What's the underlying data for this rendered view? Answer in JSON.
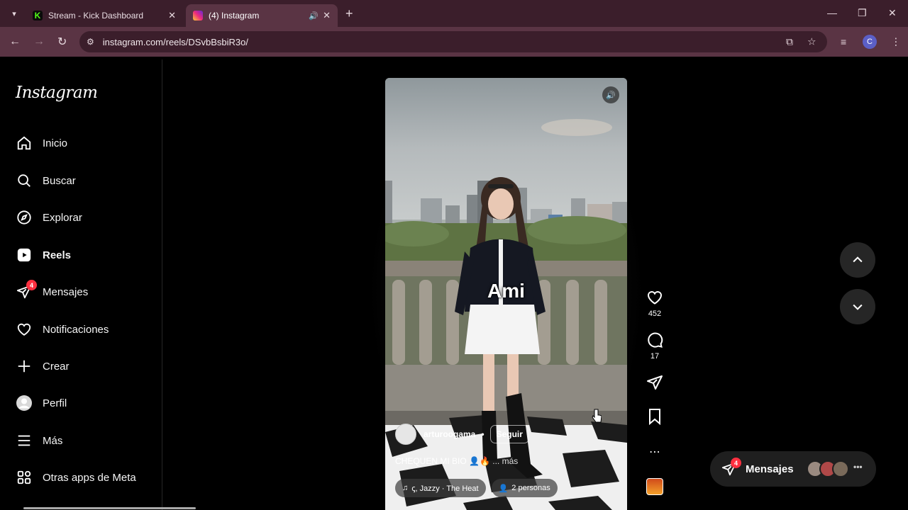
{
  "browser": {
    "tabs": [
      {
        "label": "Stream - Kick Dashboard",
        "favicon_color": "#53fc18",
        "favicon_letter": "K"
      },
      {
        "label": "(4) Instagram",
        "favicon_color": "#d6249f"
      }
    ],
    "url": "instagram.com/reels/DSvbBsbiR3o/",
    "profile_initial": "C"
  },
  "sidebar": {
    "logo": "Instagram",
    "items": [
      {
        "label": "Inicio",
        "icon": "home-icon"
      },
      {
        "label": "Buscar",
        "icon": "search-icon"
      },
      {
        "label": "Explorar",
        "icon": "compass-icon"
      },
      {
        "label": "Reels",
        "icon": "reels-icon"
      },
      {
        "label": "Mensajes",
        "icon": "messages-icon",
        "badge": "4"
      },
      {
        "label": "Notificaciones",
        "icon": "heart-icon"
      },
      {
        "label": "Crear",
        "icon": "plus-icon"
      },
      {
        "label": "Perfil",
        "icon": "avatar-icon"
      },
      {
        "label": "Más",
        "icon": "menu-icon"
      },
      {
        "label": "Otras apps de Meta",
        "icon": "apps-icon"
      }
    ]
  },
  "reel": {
    "overlay_text": "Ami",
    "author": "arturoogama",
    "follow_label": "Seguir",
    "caption": "CHEQUEN MI BIO 👤🔥",
    "caption_more": "... más",
    "audio": "ꞔ, Jazzy · The Heat",
    "people": "2 personas"
  },
  "actions": {
    "likes": "452",
    "comments": "17"
  },
  "messages_pill": {
    "label": "Mensajes",
    "badge": "4"
  }
}
